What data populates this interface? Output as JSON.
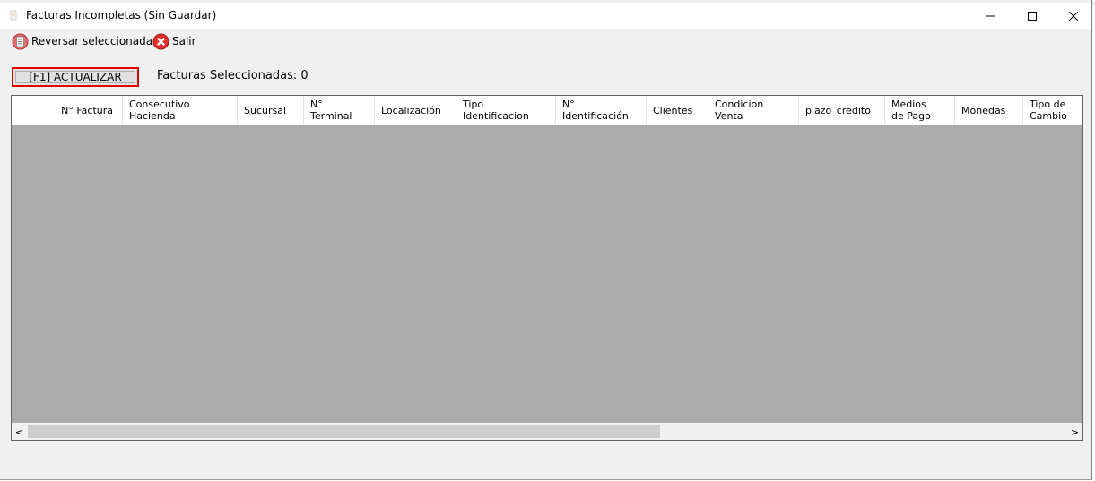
{
  "window": {
    "title": "Facturas Incompletas (Sin Guardar)",
    "minimize_glyph": "—",
    "maximize_glyph": "☐",
    "close_glyph": "✕"
  },
  "toolbar": {
    "reverse_label": "Reversar seleccionadas",
    "exit_label": "Salir"
  },
  "actions": {
    "refresh_label": "[F1] ACTUALIZAR",
    "selected_count_text": "Facturas Seleccionadas: 0"
  },
  "grid": {
    "columns": [
      "N° Factura",
      "Consecutivo\nHacienda",
      "Sucursal",
      "N°\nTerminal",
      "Localización",
      "Tipo\nIdentificacion",
      "N°\nIdentificación",
      "Clientes",
      "Condicion\nVenta",
      "plazo_credito",
      "Medios\nde Pago",
      "Monedas",
      "Tipo de\nCambio"
    ],
    "rows": []
  },
  "scrollbar": {
    "left_arrow": "<",
    "right_arrow": ">"
  },
  "colors": {
    "window_bg": "#f0f0f0",
    "grid_empty_bg": "#ababab",
    "focus_border": "#e00000"
  },
  "icons": {
    "app": "app-icon",
    "reverse": "reverse-document-icon",
    "exit": "exit-red-x-icon"
  }
}
